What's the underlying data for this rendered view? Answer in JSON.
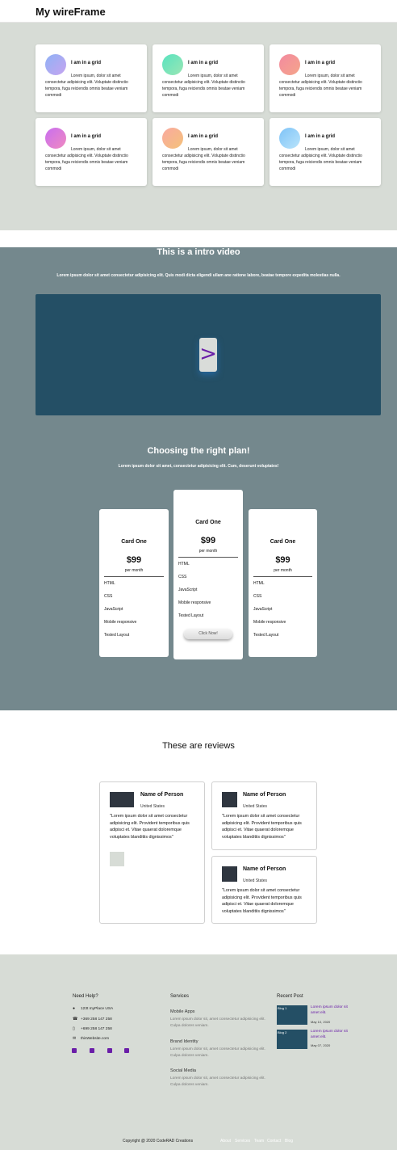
{
  "header": {
    "brand": "My wireFrame"
  },
  "features": {
    "cards": [
      {
        "title": "I am in a grid",
        "text": "Lorem ipsum, dolor sit amet consectetur adipisicing elit. Voluptate distinctio tempora, fuga reiciendis omnis beatae veniam commodi",
        "color_from": "#8fb2f5",
        "color_to": "#c6a4f0"
      },
      {
        "title": "I am in a grid",
        "text": "Lorem ipsum, dolor sit amet consectetur adipisicing elit. Voluptate distinctio tempora, fuga reiciendis omnis beatae veniam commodi",
        "color_from": "#58e3c0",
        "color_to": "#9be6b4"
      },
      {
        "title": "I am in a grid",
        "text": "Lorem ipsum, dolor sit amet consectetur adipisicing elit. Voluptate distinctio tempora, fuga reiciendis omnis beatae veniam commodi",
        "color_from": "#f38aa0",
        "color_to": "#f4a58a"
      },
      {
        "title": "I am in a grid",
        "text": "Lorem ipsum, dolor sit amet consectetur adipisicing elit. Voluptate distinctio tempora, fuga reiciendis omnis beatae veniam commodi",
        "color_from": "#c86ef0",
        "color_to": "#f08ac0"
      },
      {
        "title": "I am in a grid",
        "text": "Lorem ipsum, dolor sit amet consectetur adipisicing elit. Voluptate distinctio tempora, fuga reiciendis omnis beatae veniam commodi",
        "color_from": "#f9a9a0",
        "color_to": "#f4c27a"
      },
      {
        "title": "I am in a grid",
        "text": "Lorem ipsum, dolor sit amet consectetur adipisicing elit. Voluptate distinctio tempora, fuga reiciendis omnis beatae veniam commodi",
        "color_from": "#7fc3f7",
        "color_to": "#b9e4fb"
      }
    ]
  },
  "intro": {
    "title": "This is a intro video",
    "subtitle": "Lorem ipsum dolor sit amet consectetur adipisicing elit. Quis modi dicta eligendi ullam ane ratione labore, beatae tempore expedita molestias nulla.",
    "play_glyph": ">"
  },
  "pricing": {
    "title": "Choosing the right plan!",
    "subtitle": "Lorem ipsum dolor sit amet, consectetur adipisicing elit. Cum, deserunt voluptates!",
    "cards": [
      {
        "name": "Card One",
        "price": "$99",
        "period": "per month",
        "features": [
          "HTML",
          "CSS",
          "JavaScript",
          "Mobile responsive",
          "Tested Layout"
        ]
      },
      {
        "name": "Card One",
        "price": "$99",
        "period": "per month",
        "features": [
          "HTML",
          "CSS",
          "JavaScript",
          "Mobile responsive",
          "Tested Layout"
        ],
        "button": "Click Now!"
      },
      {
        "name": "Card One",
        "price": "$99",
        "period": "per month",
        "features": [
          "HTML",
          "CSS",
          "JavaScript",
          "Mobile responsive",
          "Tested Layout"
        ]
      }
    ]
  },
  "reviews": {
    "title": "These are reviews",
    "items": [
      {
        "name": "Name of Person",
        "location": "United States",
        "text": "\"Lorem ipsum dolor sit amet consectetur adipisicing elit. Provident temporibus quis adipisci et. Vitae quaerat doloremque voluptates blanditiis dignissimos\""
      },
      {
        "name": "Name of Person",
        "location": "United States",
        "text": "\"Lorem ipsum dolor sit amet consectetur adipisicing elit. Provident temporibus quis adipisci et. Vitae quaerat doloremque voluptates blanditiis dignissimos\""
      },
      {
        "name": "Name of Person",
        "location": "United States",
        "text": "\"Lorem ipsum dolor sit amet consectetur adipisicing elit. Provident temporibus quis adipisci et. Vitae quaerat doloremque voluptates blanditiis dignissimos\""
      }
    ]
  },
  "footer": {
    "help": {
      "heading": "Need Help?",
      "address": "123t myPlace USA",
      "phone1": "+369 258 147 258",
      "phone2": "+699 258 147 258",
      "web": "thisWebsite.com"
    },
    "services": {
      "heading": "Services",
      "items": [
        {
          "name": "Mobile Apps",
          "text": "Lorem ipsum dolor sit, amet consectetur adipisicing elit. Culpa dolores veniam."
        },
        {
          "name": "Brand Identity",
          "text": "Lorem ipsum dolor sit, amet consectetur adipisicing elit. Culpa dolores veniam."
        },
        {
          "name": "Social Media",
          "text": "Lorem ipsum dolor sit, amet consectetur adipisicing elit. Culpa dolores veniam."
        }
      ]
    },
    "recent": {
      "heading": "Recent Post",
      "posts": [
        {
          "thumb_alt": "Blog 1",
          "title": "Lorem ipsum dolor sit amet elit.",
          "date": "May 10, 2020"
        },
        {
          "thumb_alt": "Blog 2",
          "title": "Lorem ipsum dolor sit amet elit.",
          "date": "May 07, 2020"
        }
      ]
    },
    "copyright": "Copyright @ 2020 CodeRAD Creations",
    "links": [
      "About",
      "Services",
      "Team",
      "Contact",
      "Blog"
    ]
  },
  "colors": {
    "accent": "#6a1ea8",
    "panel_bg": "#d7dcd6",
    "intro_bg": "#74888d",
    "video_bg": "#244f65"
  }
}
